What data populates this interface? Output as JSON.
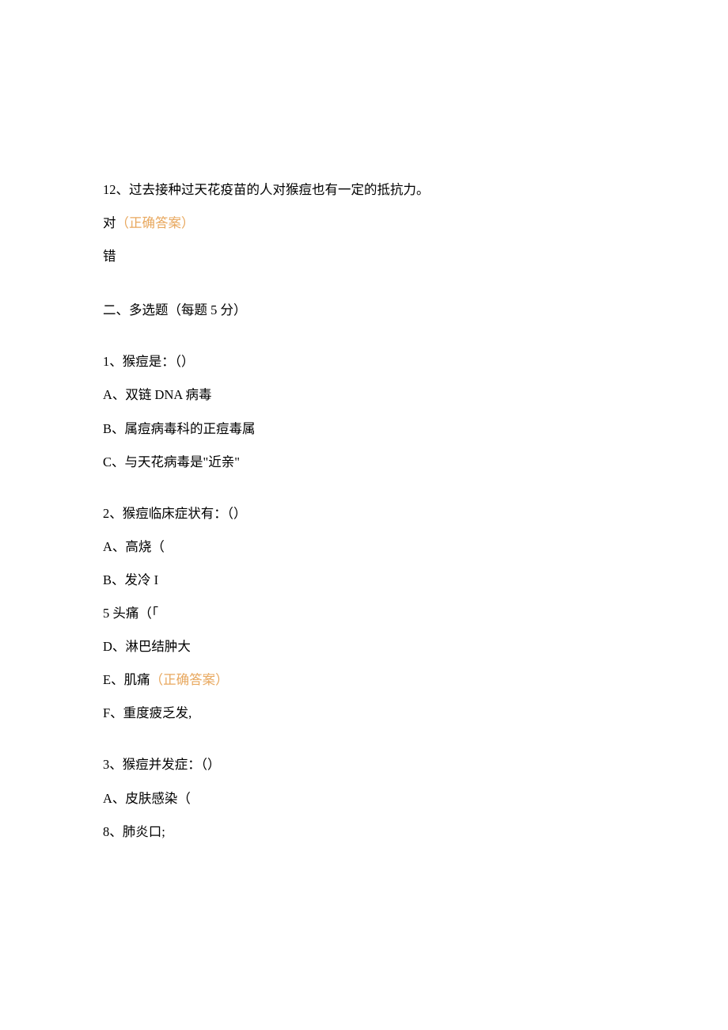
{
  "q12": {
    "text": "12、过去接种过天花疫苗的人对猴痘也有一定的抵抗力。",
    "opt_true_prefix": "对",
    "opt_true_tag": "（正确答案）",
    "opt_false": "错"
  },
  "section2": {
    "heading": "二、多选题（每题 5 分）"
  },
  "mq1": {
    "text": "1、猴痘是：（）",
    "optA_pre": "A、双链 ",
    "optA_latin": "DNA ",
    "optA_post": "病毒",
    "optB": "B、属痘病毒科的正痘毒属",
    "optC": "C、与天花病毒是\"近亲\""
  },
  "mq2": {
    "text": "2、猴痘临床症状有：（）",
    "optA": "A、高烧（",
    "optB_pre": "B、发冷 ",
    "optB_latin": "I",
    "optC_pre": "5 ",
    "optC_post": "头痛（「",
    "optD": "D、淋巴结肿大",
    "optE_prefix": "E、肌痛",
    "optE_tag": "（正确答案）",
    "optF": "F、重度疲乏发,"
  },
  "mq3": {
    "text": "3、猴痘并发症：（）",
    "optA": "A、皮肤感染（",
    "optB": "8、肺炎口;"
  }
}
